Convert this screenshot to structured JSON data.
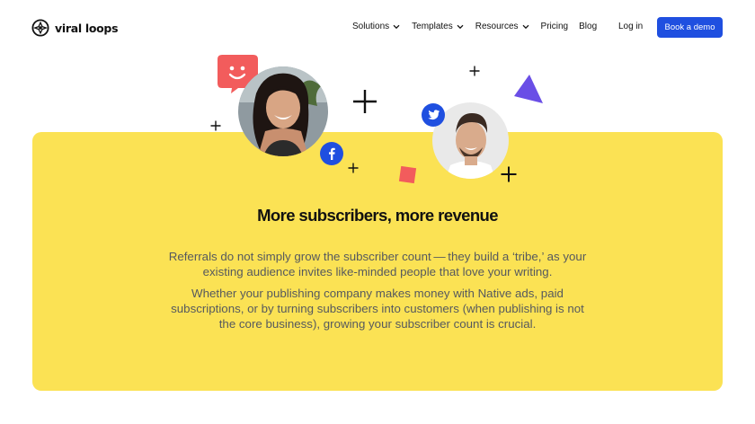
{
  "brand": {
    "name": "viral loops"
  },
  "nav": {
    "menu": [
      {
        "label": "Solutions",
        "dropdown": true
      },
      {
        "label": "Templates",
        "dropdown": true
      },
      {
        "label": "Resources",
        "dropdown": true
      },
      {
        "label": "Pricing",
        "dropdown": false
      },
      {
        "label": "Blog",
        "dropdown": false
      }
    ],
    "login_label": "Log in",
    "cta_label": "Book a demo"
  },
  "hero": {
    "title": "More subscribers, more revenue",
    "paragraph_1": "Referrals do not simply grow the subscriber count — they build a ‘tribe,’ as your existing audience invites like-minded people that love your writing.",
    "paragraph_2": "Whether your publishing company makes money with Native ads, paid subscriptions, or by turning subscribers into customers (when publishing is not the core business), growing your subscriber count is crucial."
  },
  "colors": {
    "accent_blue": "#1f4fe0",
    "card_yellow": "#fbe254",
    "coral": "#f25c5c",
    "purple": "#6a4ee6",
    "body_text": "#56595e"
  },
  "icons": [
    "viral-loops-logo-icon",
    "chevron-down-icon",
    "smiley-chat-icon",
    "facebook-icon",
    "twitter-icon",
    "triangle-shape",
    "square-shape",
    "plus-sign"
  ]
}
